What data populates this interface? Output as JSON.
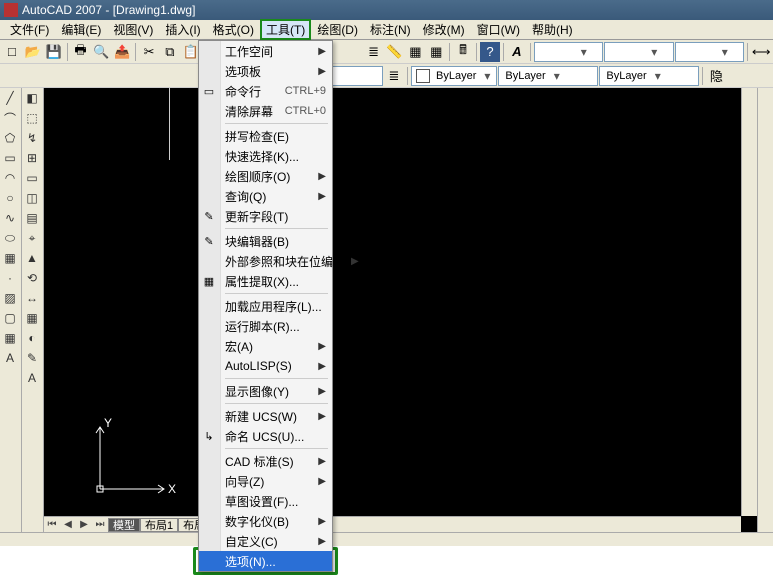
{
  "title": "AutoCAD 2007 - [Drawing1.dwg]",
  "menus": {
    "file": "文件(F)",
    "edit": "编辑(E)",
    "view": "视图(V)",
    "insert": "插入(I)",
    "format": "格式(O)",
    "tools": "工具(T)",
    "draw": "绘图(D)",
    "dim": "标注(N)",
    "modify": "修改(M)",
    "window": "窗口(W)",
    "help": "帮助(H)"
  },
  "toolbar2": {
    "layer_combo": "",
    "linetype_combo": "ByLayer",
    "lineweight_combo": "ByLayer",
    "color_combo": "ByLayer"
  },
  "tabs": {
    "model": "模型",
    "layout1": "布局1",
    "layout2": "布局2"
  },
  "ucs": {
    "x": "X",
    "y": "Y"
  },
  "dropdown": {
    "items": [
      {
        "label": "工作空间",
        "arrow": true
      },
      {
        "label": "选项板",
        "arrow": true
      },
      {
        "label": "命令行",
        "shortcut": "CTRL+9",
        "icon": "▭"
      },
      {
        "label": "清除屏幕",
        "shortcut": "CTRL+0"
      },
      {
        "sep": true
      },
      {
        "label": "拼写检查(E)"
      },
      {
        "label": "快速选择(K)..."
      },
      {
        "label": "绘图顺序(O)",
        "arrow": true
      },
      {
        "label": "查询(Q)",
        "arrow": true
      },
      {
        "label": "更新字段(T)",
        "icon": "✎"
      },
      {
        "sep": true
      },
      {
        "label": "块编辑器(B)",
        "icon": "✎"
      },
      {
        "label": "外部参照和块在位编辑",
        "arrow": true
      },
      {
        "label": "属性提取(X)...",
        "icon": "▦"
      },
      {
        "sep": true
      },
      {
        "label": "加载应用程序(L)..."
      },
      {
        "label": "运行脚本(R)..."
      },
      {
        "label": "宏(A)",
        "arrow": true
      },
      {
        "label": "AutoLISP(S)",
        "arrow": true
      },
      {
        "sep": true
      },
      {
        "label": "显示图像(Y)",
        "arrow": true
      },
      {
        "sep": true
      },
      {
        "label": "新建 UCS(W)",
        "arrow": true
      },
      {
        "label": "命名 UCS(U)...",
        "icon": "↳"
      },
      {
        "sep": true
      },
      {
        "label": "CAD 标准(S)",
        "arrow": true
      },
      {
        "label": "向导(Z)",
        "arrow": true
      },
      {
        "label": "草图设置(F)..."
      },
      {
        "label": "数字化仪(B)",
        "arrow": true
      },
      {
        "label": "自定义(C)",
        "arrow": true
      },
      {
        "label": "选项(N)...",
        "selected": true
      }
    ]
  },
  "icons": {
    "new": "□",
    "open": "📂",
    "save": "💾",
    "plot": "🖶",
    "preview": "🔍",
    "publish": "📤",
    "cut": "✂",
    "copy": "⧉",
    "paste": "📋",
    "match": "✎",
    "undo": "↶",
    "redo": "↷",
    "pan": "✋",
    "zoom": "🔍",
    "layers": "≣",
    "ruler": "📏",
    "help": "?",
    "textA": "A",
    "line": "╱",
    "pline": "⌒",
    "polygon": "⬠",
    "rect": "▭",
    "arc": "◠",
    "circle": "○",
    "spline": "∿",
    "ellipse": "⬭",
    "block": "▦",
    "point": "·",
    "hatch": "▨",
    "region": "▢",
    "table": "▦",
    "text": "A",
    "r1": "◧",
    "r2": "⬚",
    "r3": "↯",
    "r4": "⊞",
    "r5": "▭",
    "r6": "◫",
    "r7": "▤",
    "r8": "⌖",
    "r9": "▲",
    "r10": "⟲",
    "r11": "↔",
    "r12": "▦",
    "r13": "◐",
    "r14": "✎",
    "r15": "A"
  }
}
